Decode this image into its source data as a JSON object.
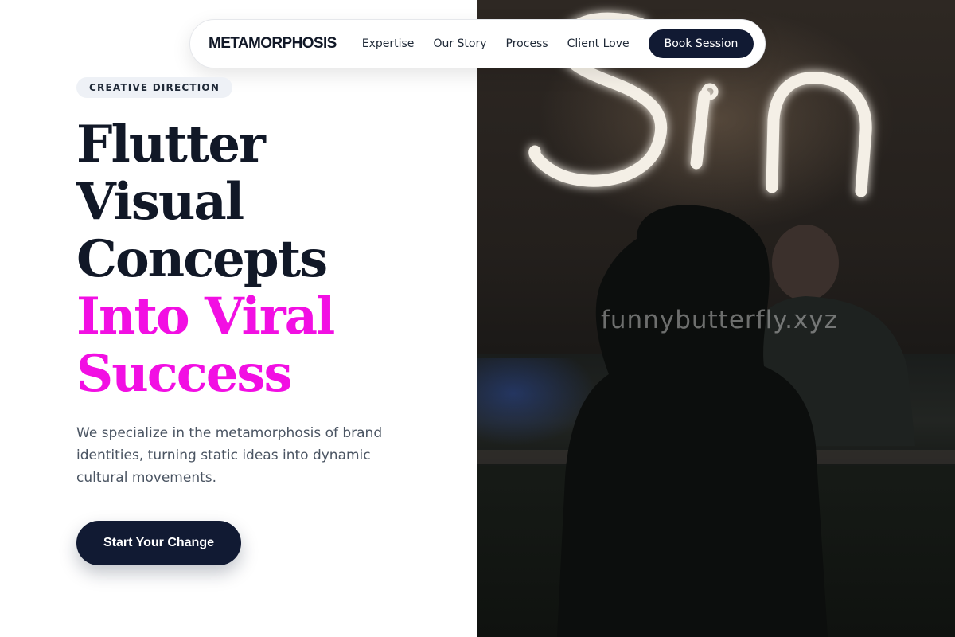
{
  "nav": {
    "brand": "METAMORPHOSIS",
    "links": [
      "Expertise",
      "Our Story",
      "Process",
      "Client Love"
    ],
    "cta_label": "Book Session"
  },
  "hero": {
    "tag": "CREATIVE DIRECTION",
    "headline_lines": [
      "Flutter",
      "Visual",
      "Concepts"
    ],
    "headline_accent_lines": [
      "Into Viral",
      "Success"
    ],
    "description": "We specialize in the metamorphosis of brand identities, turning static ideas into dynamic cultural movements.",
    "cta_label": "Start Your Change"
  },
  "image": {
    "neon_text": "Sin",
    "watermark": "funnybutterfly.xyz"
  },
  "colors": {
    "accent": "#f20fe3",
    "dark": "#111a33",
    "text": "#111827",
    "muted": "#4b5563"
  }
}
